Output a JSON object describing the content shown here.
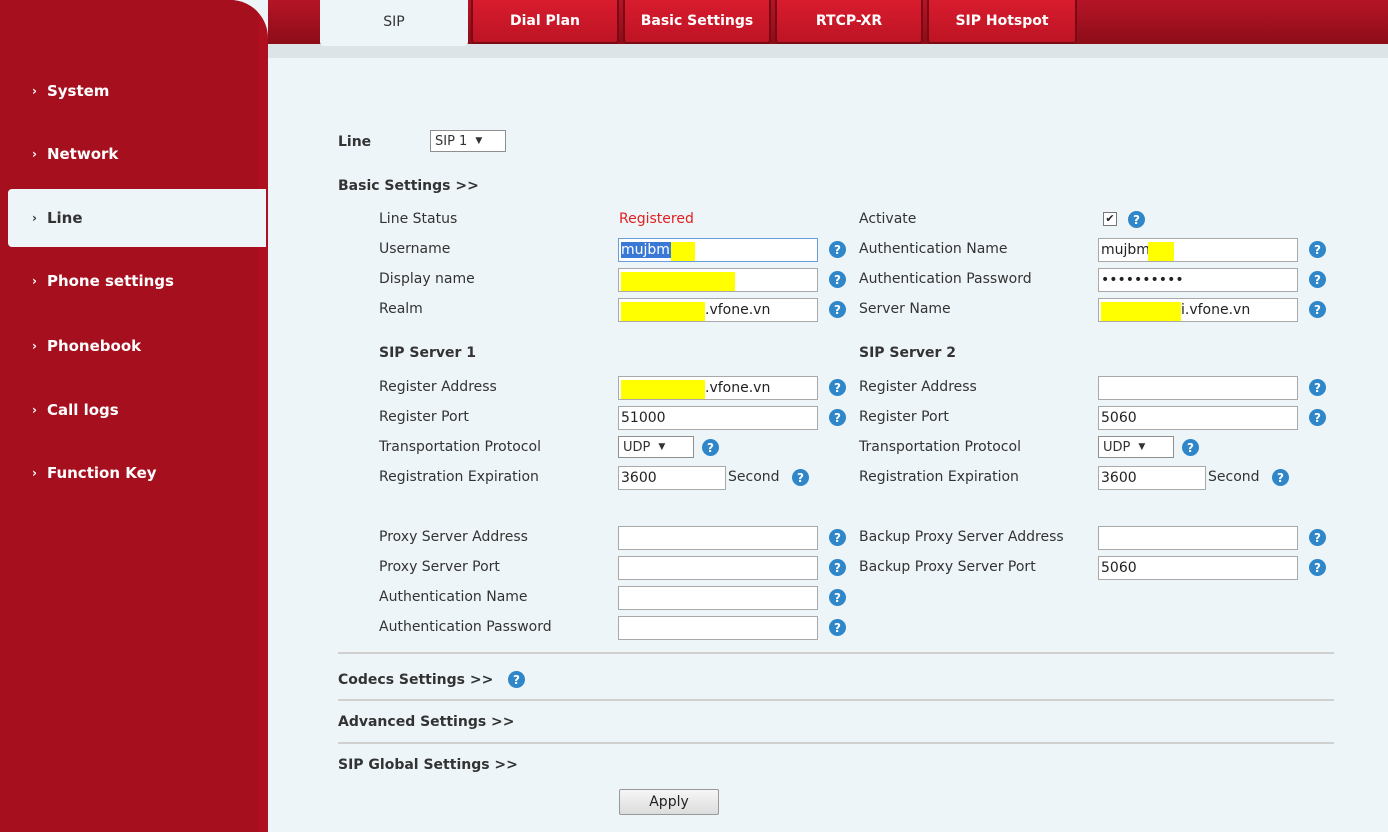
{
  "sidebar": {
    "items": [
      {
        "label": "System"
      },
      {
        "label": "Network"
      },
      {
        "label": "Line"
      },
      {
        "label": "Phone settings"
      },
      {
        "label": "Phonebook"
      },
      {
        "label": "Call logs"
      },
      {
        "label": "Function Key"
      }
    ]
  },
  "tabs": [
    {
      "label": "SIP"
    },
    {
      "label": "Dial Plan"
    },
    {
      "label": "Basic Settings"
    },
    {
      "label": "RTCP-XR"
    },
    {
      "label": "SIP Hotspot"
    }
  ],
  "line": {
    "label": "Line",
    "selected": "SIP 1"
  },
  "basic": {
    "header": "Basic Settings >>",
    "line_status_label": "Line Status",
    "line_status_value": "Registered",
    "activate_label": "Activate",
    "activate_checked": "✔",
    "username_label": "Username",
    "username_value": "mujbm6",
    "auth_name_label": "Authentication Name",
    "auth_name_value": "mujbm",
    "display_name_label": "Display name",
    "auth_password_label": "Authentication Password",
    "auth_password_value": "••••••••••",
    "realm_label": "Realm",
    "realm_value": ".vfone.vn",
    "server_name_label": "Server Name",
    "server_name_value": "i.vfone.vn"
  },
  "server1": {
    "title": "SIP Server 1",
    "register_address_label": "Register Address",
    "register_address_value": ".vfone.vn",
    "register_port_label": "Register Port",
    "register_port_value": "51000",
    "transport_label": "Transportation Protocol",
    "transport_value": "UDP",
    "expiration_label": "Registration Expiration",
    "expiration_value": "3600",
    "expiration_unit": "Second"
  },
  "server2": {
    "title": "SIP Server 2",
    "register_address_label": "Register Address",
    "register_address_value": "",
    "register_port_label": "Register Port",
    "register_port_value": "5060",
    "transport_label": "Transportation Protocol",
    "transport_value": "UDP",
    "expiration_label": "Registration Expiration",
    "expiration_value": "3600",
    "expiration_unit": "Second"
  },
  "proxy": {
    "address_label": "Proxy Server Address",
    "port_label": "Proxy Server Port",
    "auth_name_label": "Authentication Name",
    "auth_password_label": "Authentication Password",
    "backup_address_label": "Backup Proxy Server Address",
    "backup_port_label": "Backup Proxy Server Port",
    "backup_port_value": "5060"
  },
  "sections": {
    "codecs": "Codecs Settings >>",
    "advanced": "Advanced Settings >>",
    "sip_global": "SIP Global Settings >>"
  },
  "apply_label": "Apply",
  "help_glyph": "?",
  "chevron_glyph": "›",
  "dropdown_glyph": "▼",
  "colors": {
    "brand_red": "#a60f1e",
    "status_registered": "#e02020",
    "help_blue": "#2f86c9",
    "redaction": "#ffff00"
  }
}
